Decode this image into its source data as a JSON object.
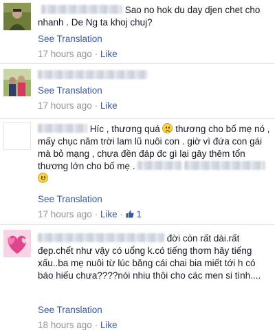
{
  "comments": [
    {
      "text": "Sao no hok du day djen chet cho nhanh . De Ng ta khoj chuj?",
      "see_translation": "See Translation",
      "time": "17 hours ago",
      "separator": " · ",
      "like": "Like"
    },
    {
      "text": "",
      "see_translation": "See Translation",
      "time": "17 hours ago",
      "separator": " · ",
      "like": "Like"
    },
    {
      "text_a": "Híc , thương quá",
      "text_b": "thương cho bố mẹ nó , mấy chục năm trời lam lũ nuôi con . giờ vì đứa con gái mà bỏ mạng , chưa đền đáp đc gì lại gây thêm tổn thương lớn cho bố mẹ .",
      "emoji_a": "sad-emoji",
      "emoji_b": "smile-emoji",
      "see_translation": "See Translation",
      "time": "17 hours ago",
      "separator": " · ",
      "like": "Like",
      "like_count": "1"
    },
    {
      "text": "đời còn rất dài.rất đẹp.chết như vậy có uổng k.có tiếng thơm hây tiếng xấu..ba mẹ nuôi từ lúc băng cái chai bia miết tới h có báo hiếu chưa????nói nhiu thôi cho các men si tình....",
      "see_translation": "See Translation",
      "time": "18 hours ago",
      "separator": " · ",
      "like": "Like"
    }
  ],
  "colors": {
    "link": "#3b5998",
    "meta": "#90949c",
    "text": "#141823",
    "divider": "#e1e2e3"
  },
  "icons": [
    "avatar-man",
    "avatar-couple",
    "avatar-blank",
    "avatar-hearts",
    "sad-emoji",
    "smile-emoji",
    "like-thumb-icon"
  ]
}
